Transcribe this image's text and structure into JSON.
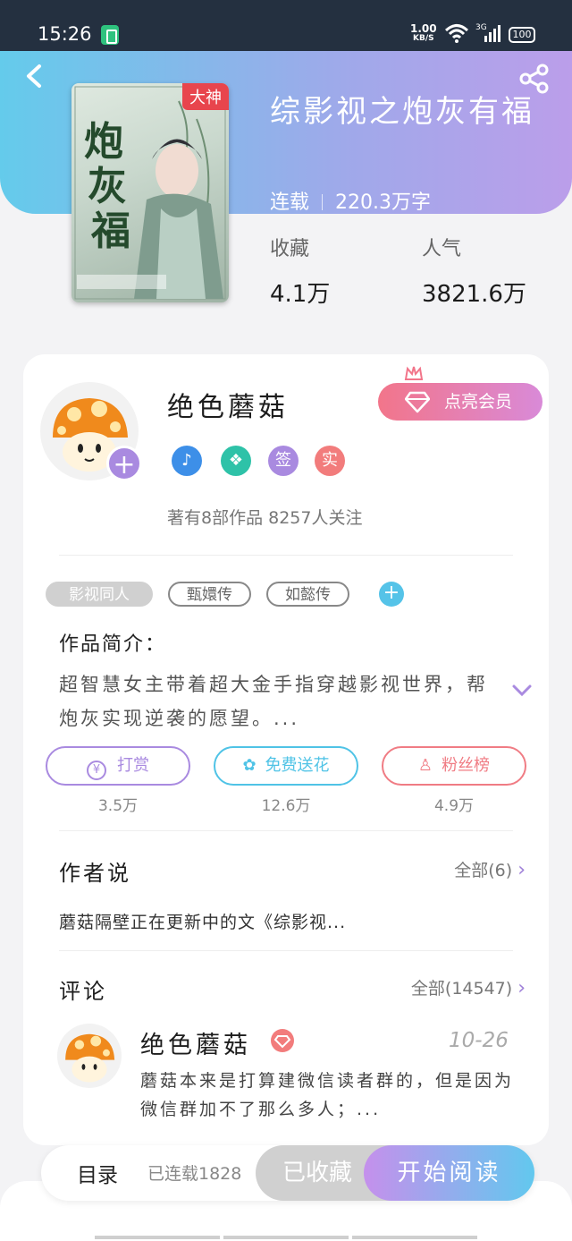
{
  "status_bar": {
    "time": "15:26",
    "speed": "1.00",
    "speed_unit": "KB/S",
    "signal": "3G",
    "battery": "100"
  },
  "book": {
    "title": "综影视之炮灰有福",
    "cover_badge": "大神",
    "status": "连载",
    "word_count": "220.3万字",
    "favorites_label": "收藏",
    "favorites_value": "4.1万",
    "popularity_label": "人气",
    "popularity_value": "3821.6万"
  },
  "author": {
    "name": "绝色蘑菇",
    "vip_button": "点亮会员",
    "badges": [
      {
        "icon": "music-badge-icon"
      },
      {
        "icon": "handshake-badge-icon"
      },
      {
        "label": "签"
      },
      {
        "label": "实"
      }
    ],
    "follow_text": "著有8部作品 8257人关注"
  },
  "tags": [
    "影视同人",
    "甄嬛传",
    "如懿传"
  ],
  "intro": {
    "label": "作品简介：",
    "text": "超智慧女主带着超大金手指穿越影视世界，帮炮灰实现逆袭的愿望。..."
  },
  "actions": [
    {
      "label": "打赏",
      "count": "3.5万",
      "color": "#a98ae0",
      "icon": "yen-icon"
    },
    {
      "label": "免费送花",
      "count": "12.6万",
      "color": "#4fc3e6",
      "icon": "flower-icon"
    },
    {
      "label": "粉丝榜",
      "count": "4.9万",
      "color": "#f07c84",
      "icon": "fan-icon"
    }
  ],
  "author_says": {
    "title": "作者说",
    "more": "全部(6)",
    "text": "蘑菇隔壁正在更新中的文《综影视..."
  },
  "comments": {
    "title": "评论",
    "more": "全部(14547)",
    "items": [
      {
        "name": "绝色蘑菇",
        "date": "10-26",
        "text": "蘑菇本来是打算建微信读者群的，但是因为微信群加不了那么多人；..."
      }
    ]
  },
  "bottom": {
    "toc_label": "目录",
    "toc_sub": "已连载1828",
    "favorite_button": "已收藏",
    "read_button": "开始阅读"
  },
  "colors": {
    "header_start": "#64cbeb",
    "header_end": "#bb9eea",
    "vip": "#f2758a",
    "accent_purple": "#a98ae0"
  }
}
